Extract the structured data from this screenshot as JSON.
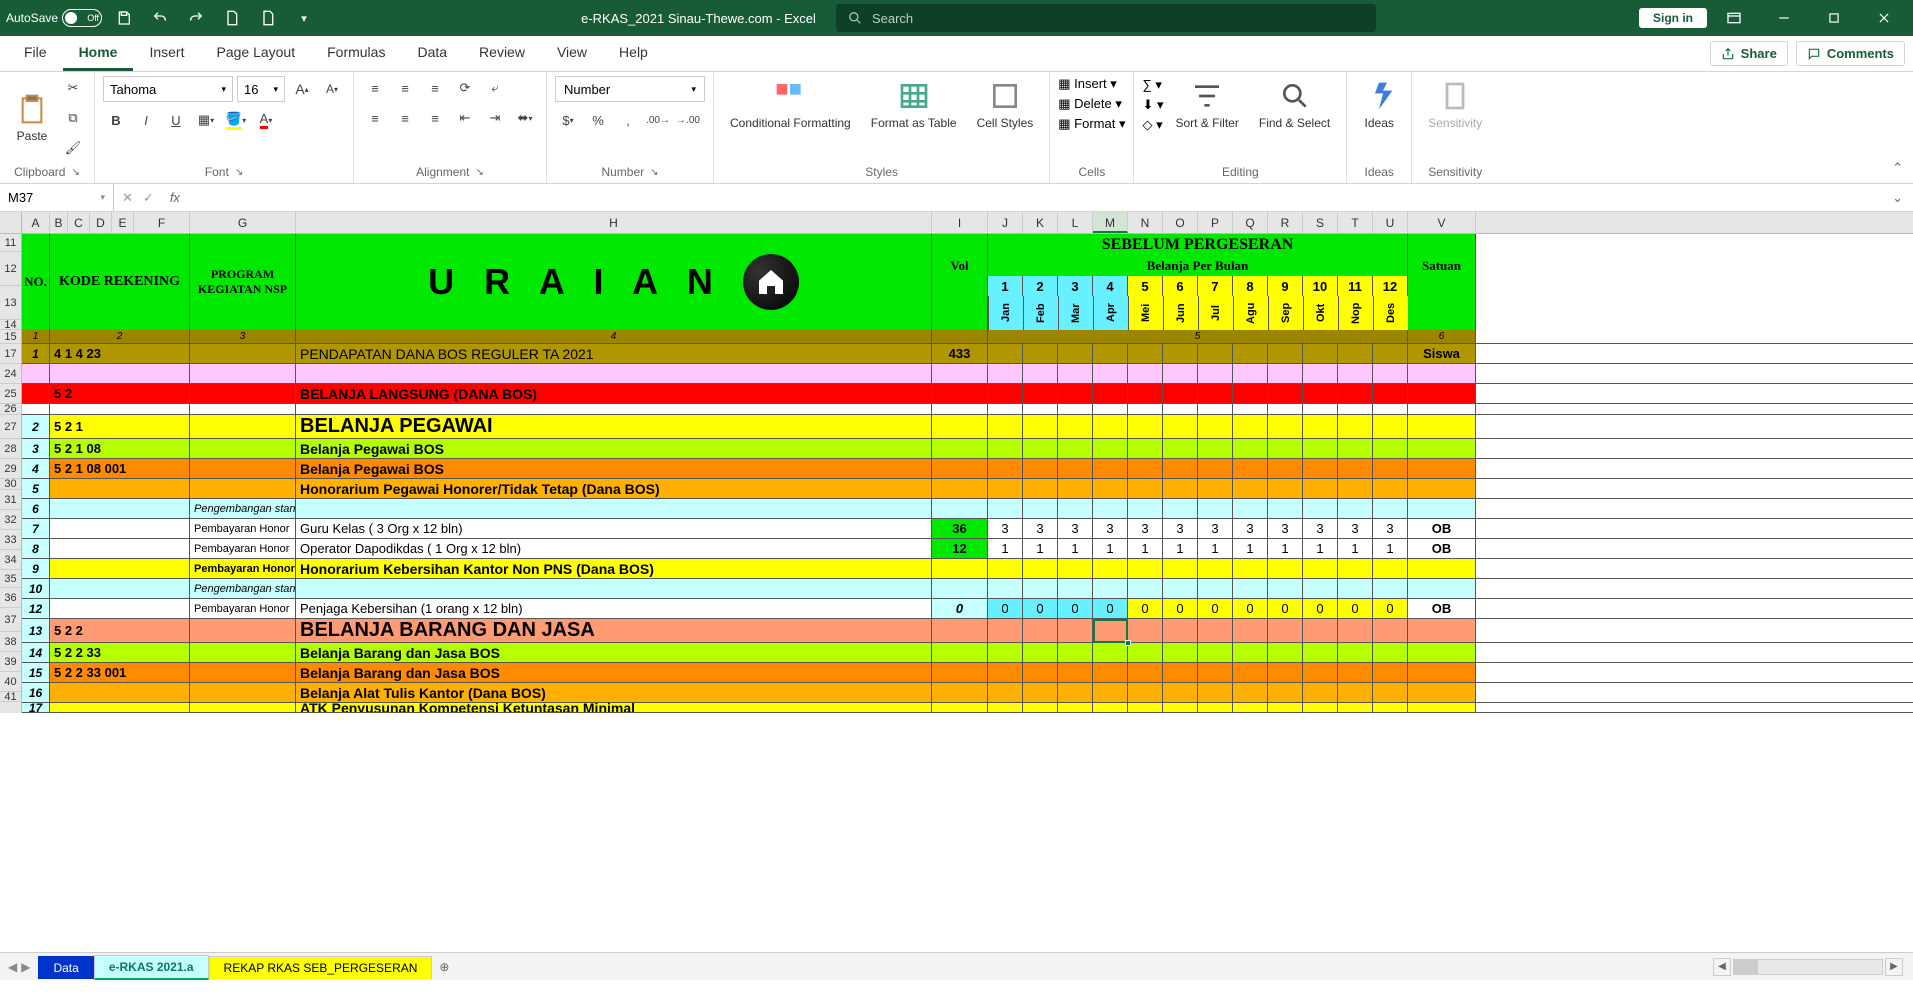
{
  "titlebar": {
    "autosave_label": "AutoSave",
    "autosave_state": "Off",
    "doc_title": "e-RKAS_2021 Sinau-Thewe.com  -  Excel",
    "search_placeholder": "Search",
    "signin": "Sign in"
  },
  "ribbon_tabs": [
    "File",
    "Home",
    "Insert",
    "Page Layout",
    "Formulas",
    "Data",
    "Review",
    "View",
    "Help"
  ],
  "active_tab": "Home",
  "share_label": "Share",
  "comments_label": "Comments",
  "ribbon": {
    "clipboard": {
      "label": "Clipboard",
      "paste": "Paste"
    },
    "font": {
      "label": "Font",
      "name": "Tahoma",
      "size": "16",
      "bold": "B",
      "italic": "I",
      "underline": "U"
    },
    "alignment": {
      "label": "Alignment"
    },
    "number": {
      "label": "Number",
      "format": "Number"
    },
    "styles": {
      "label": "Styles",
      "cond": "Conditional Formatting",
      "table": "Format as Table",
      "cell": "Cell Styles"
    },
    "cells": {
      "label": "Cells",
      "insert": "Insert",
      "delete": "Delete",
      "format": "Format"
    },
    "editing": {
      "label": "Editing",
      "sort": "Sort & Filter",
      "find": "Find & Select"
    },
    "ideas": {
      "label": "Ideas",
      "btn": "Ideas"
    },
    "sensitivity": {
      "label": "Sensitivity",
      "btn": "Sensitivity"
    }
  },
  "namebox": "M37",
  "col_headers": [
    "A",
    "B",
    "C",
    "D",
    "E",
    "F",
    "G",
    "H",
    "I",
    "J",
    "K",
    "L",
    "M",
    "N",
    "O",
    "P",
    "Q",
    "R",
    "S",
    "T",
    "U",
    "V"
  ],
  "row_headers": [
    "11",
    "12",
    "13",
    "14",
    "15",
    "17",
    "24",
    "25",
    "26",
    "27",
    "28",
    "29",
    "30",
    "31",
    "32",
    "33",
    "34",
    "35",
    "36",
    "37",
    "38",
    "39",
    "40",
    "41"
  ],
  "table_headers": {
    "no": "NO.",
    "kode": "KODE REKENING",
    "program": "PROGRAM KEGIATAN NSP",
    "uraian": "U R A I A N",
    "vol": "Vol",
    "sebelum": "SEBELUM PERGESERAN",
    "belanja": "Belanja Per Bulan",
    "satuan": "Satuan"
  },
  "months": [
    {
      "num": "1",
      "name": "Jan"
    },
    {
      "num": "2",
      "name": "Feb"
    },
    {
      "num": "3",
      "name": "Mar"
    },
    {
      "num": "4",
      "name": "Apr"
    },
    {
      "num": "5",
      "name": "Mei"
    },
    {
      "num": "6",
      "name": "Jun"
    },
    {
      "num": "7",
      "name": "Jul"
    },
    {
      "num": "8",
      "name": "Agu"
    },
    {
      "num": "9",
      "name": "Sep"
    },
    {
      "num": "10",
      "name": "Okt"
    },
    {
      "num": "11",
      "name": "Nop"
    },
    {
      "num": "12",
      "name": "Des"
    }
  ],
  "idx_row": {
    "i1": "1",
    "i2": "2",
    "i3": "3",
    "i4": "4",
    "i5": "5",
    "i6": "6"
  },
  "rows": [
    {
      "no": "1",
      "kode": "4  1  4  23",
      "prog": "",
      "uraian": "PENDAPATAN DANA BOS REGULER TA 2021",
      "vol": "433",
      "m": [
        "",
        "",
        "",
        "",
        "",
        "",
        "",
        "",
        "",
        "",
        "",
        ""
      ],
      "sat": "Siswa",
      "cls": "row-olive"
    },
    {
      "no": "",
      "kode": "",
      "prog": "",
      "uraian": "",
      "vol": "",
      "m": [
        "",
        "",
        "",
        "",
        "",
        "",
        "",
        "",
        "",
        "",
        "",
        ""
      ],
      "sat": "",
      "cls": "row-pink"
    },
    {
      "no": "",
      "kode": "5  2",
      "prog": "",
      "uraian": "BELANJA LANGSUNG (DANA BOS)",
      "vol": "",
      "m": [
        "",
        "",
        "",
        "",
        "",
        "",
        "",
        "",
        "",
        "",
        "",
        ""
      ],
      "sat": "",
      "cls": "row-red"
    },
    {
      "no": "",
      "kode": "",
      "prog": "",
      "uraian": "",
      "vol": "",
      "m": [
        "",
        "",
        "",
        "",
        "",
        "",
        "",
        "",
        "",
        "",
        "",
        ""
      ],
      "sat": "",
      "cls": "row-white"
    },
    {
      "no": "2",
      "kode": "5  2  1",
      "prog": "",
      "uraian": "BELANJA PEGAWAI",
      "vol": "",
      "m": [
        "",
        "",
        "",
        "",
        "",
        "",
        "",
        "",
        "",
        "",
        "",
        ""
      ],
      "sat": "",
      "cls": "row-yellow",
      "big": true
    },
    {
      "no": "3",
      "kode": "5  2  1  08",
      "prog": "",
      "uraian": "Belanja Pegawai BOS",
      "vol": "",
      "m": [
        "",
        "",
        "",
        "",
        "",
        "",
        "",
        "",
        "",
        "",
        "",
        ""
      ],
      "sat": "",
      "cls": "row-lime"
    },
    {
      "no": "4",
      "kode": "5  2  1  08  001",
      "prog": "",
      "uraian": "Belanja Pegawai BOS",
      "vol": "",
      "m": [
        "",
        "",
        "",
        "",
        "",
        "",
        "",
        "",
        "",
        "",
        "",
        ""
      ],
      "sat": "",
      "cls": "row-orange"
    },
    {
      "no": "5",
      "kode": "",
      "prog": "",
      "uraian": "Honorarium Pegawai Honorer/Tidak Tetap (Dana BOS)",
      "vol": "",
      "m": [
        "",
        "",
        "",
        "",
        "",
        "",
        "",
        "",
        "",
        "",
        "",
        ""
      ],
      "sat": "",
      "cls": "row-orange2"
    },
    {
      "no": "6",
      "kode": "",
      "prog": "Pengembangan standar pembiayaan",
      "uraian": "",
      "vol": "",
      "m": [
        "",
        "",
        "",
        "",
        "",
        "",
        "",
        "",
        "",
        "",
        "",
        ""
      ],
      "sat": "",
      "cls": "row-lblue"
    },
    {
      "no": "7",
      "kode": "",
      "prog": "Pembayaran Honor",
      "uraian": "Guru Kelas ( 3 Org x 12 bln)",
      "vol": "36",
      "volcls": "row-patch-green",
      "m": [
        "3",
        "3",
        "3",
        "3",
        "3",
        "3",
        "3",
        "3",
        "3",
        "3",
        "3",
        "3"
      ],
      "sat": "OB",
      "cls": "row-white"
    },
    {
      "no": "8",
      "kode": "",
      "prog": "Pembayaran Honor",
      "uraian": "Operator Dapodikdas ( 1 Org x 12 bln)",
      "vol": "12",
      "volcls": "row-patch-green",
      "m": [
        "1",
        "1",
        "1",
        "1",
        "1",
        "1",
        "1",
        "1",
        "1",
        "1",
        "1",
        "1"
      ],
      "sat": "OB",
      "cls": "row-white"
    },
    {
      "no": "9",
      "kode": "",
      "prog": "Pembayaran Honor",
      "uraian": "Honorarium Kebersihan Kantor Non PNS (Dana BOS)",
      "vol": "",
      "m": [
        "",
        "",
        "",
        "",
        "",
        "",
        "",
        "",
        "",
        "",
        "",
        ""
      ],
      "sat": "",
      "cls": "row-yellow"
    },
    {
      "no": "10",
      "kode": "",
      "prog": "Pengembangan standar pembiayaan",
      "uraian": "",
      "vol": "",
      "m": [
        "",
        "",
        "",
        "",
        "",
        "",
        "",
        "",
        "",
        "",
        "",
        ""
      ],
      "sat": "",
      "cls": "row-lblue"
    },
    {
      "no": "12",
      "kode": "",
      "prog": "Pembayaran Honor",
      "uraian": "Penjaga Kebersihan (1 orang x 12 bln)",
      "vol": "0",
      "volcls": "row-lblue",
      "m": [
        "0",
        "0",
        "0",
        "0",
        "0",
        "0",
        "0",
        "0",
        "0",
        "0",
        "0",
        "0"
      ],
      "mcyan": 4,
      "sat": "OB",
      "cls": "row-white"
    },
    {
      "no": "13",
      "kode": "5  2  2",
      "prog": "",
      "uraian": "BELANJA BARANG DAN JASA",
      "vol": "",
      "m": [
        "",
        "",
        "",
        "",
        "",
        "",
        "",
        "",
        "",
        "",
        "",
        ""
      ],
      "sat": "",
      "cls": "row-salmon",
      "big": true
    },
    {
      "no": "14",
      "kode": "5  2  2  33",
      "prog": "",
      "uraian": "Belanja Barang dan Jasa BOS",
      "vol": "",
      "m": [
        "",
        "",
        "",
        "",
        "",
        "",
        "",
        "",
        "",
        "",
        "",
        ""
      ],
      "sat": "",
      "cls": "row-lime"
    },
    {
      "no": "15",
      "kode": "5  2  2  33  001",
      "prog": "",
      "uraian": "Belanja Barang dan Jasa BOS",
      "vol": "",
      "m": [
        "",
        "",
        "",
        "",
        "",
        "",
        "",
        "",
        "",
        "",
        "",
        ""
      ],
      "sat": "",
      "cls": "row-orange"
    },
    {
      "no": "16",
      "kode": "",
      "prog": "",
      "uraian": "Belanja Alat Tulis Kantor (Dana BOS)",
      "vol": "",
      "m": [
        "",
        "",
        "",
        "",
        "",
        "",
        "",
        "",
        "",
        "",
        "",
        ""
      ],
      "sat": "",
      "cls": "row-orange2"
    },
    {
      "no": "17",
      "kode": "",
      "prog": "",
      "uraian": "ATK Penyusunan Kompetensi Ketuntasan Minimal",
      "vol": "",
      "m": [
        "",
        "",
        "",
        "",
        "",
        "",
        "",
        "",
        "",
        "",
        "",
        ""
      ],
      "sat": "",
      "cls": "row-yellow",
      "cut": true
    }
  ],
  "sheets": [
    "Data",
    "e-RKAS 2021.a",
    "REKAP RKAS SEB_PERGESERAN"
  ]
}
